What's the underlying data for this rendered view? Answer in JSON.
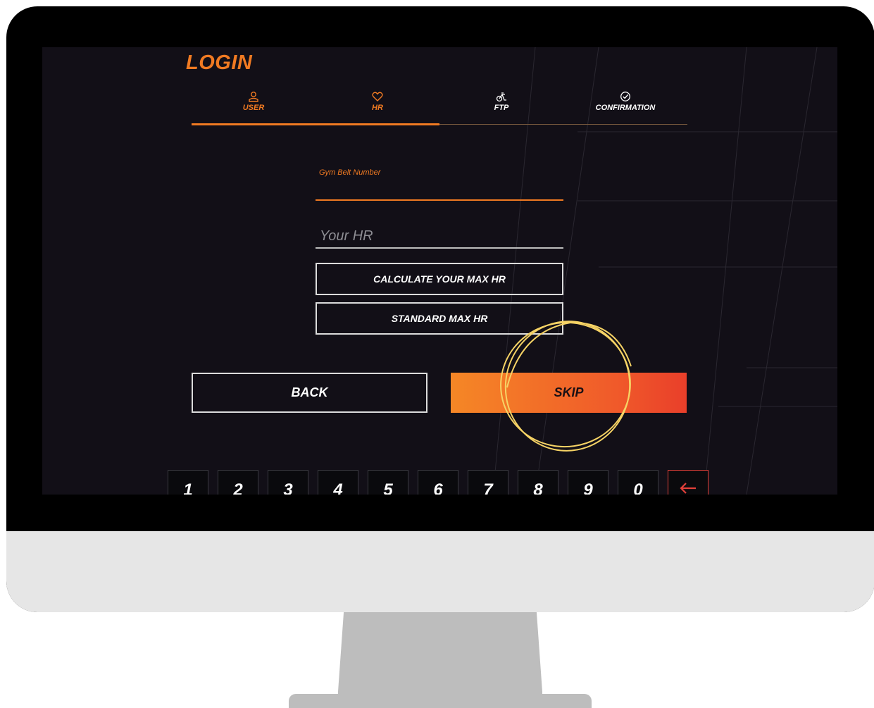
{
  "title": "LOGIN",
  "steps": [
    {
      "label": "USER",
      "icon": "user-icon"
    },
    {
      "label": "HR",
      "icon": "heart-icon"
    },
    {
      "label": "FTP",
      "icon": "bike-icon"
    },
    {
      "label": "CONFIRMATION",
      "icon": "check-circle-icon"
    }
  ],
  "form": {
    "belt_label": "Gym Belt Number",
    "belt_value": "",
    "hr_placeholder": "Your HR",
    "hr_value": "",
    "calculate_label": "CALCULATE YOUR MAX HR",
    "standard_label": "STANDARD MAX HR"
  },
  "actions": {
    "back_label": "BACK",
    "skip_label": "SKIP"
  },
  "keypad": {
    "keys": [
      "1",
      "2",
      "3",
      "4",
      "5",
      "6",
      "7",
      "8",
      "9",
      "0"
    ],
    "backspace_icon": "arrow-left-icon"
  },
  "colors": {
    "accent": "#f07a22",
    "skip_gradient_end": "#e93f2a",
    "annotation": "#f6d365"
  }
}
